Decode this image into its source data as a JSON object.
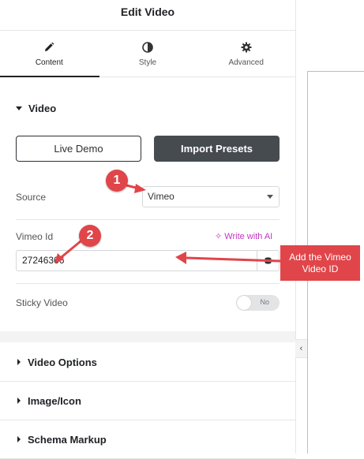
{
  "header": {
    "title": "Edit Video"
  },
  "tabs": [
    {
      "label": "Content",
      "icon": "pencil-icon"
    },
    {
      "label": "Style",
      "icon": "half-circle-icon"
    },
    {
      "label": "Advanced",
      "icon": "gear-icon"
    }
  ],
  "video_section": {
    "title": "Video",
    "demo_button": "Live Demo",
    "import_button": "Import Presets",
    "source_label": "Source",
    "source_value": "Vimeo",
    "vimeo_label": "Vimeo Id",
    "ai_link": "Write with AI",
    "vimeo_value": "27246366",
    "sticky_label": "Sticky Video",
    "sticky_toggle": "No"
  },
  "collapsed_sections": [
    "Video Options",
    "Image/Icon",
    "Schema Markup"
  ],
  "annotations": {
    "marker_1": "1",
    "marker_2": "2",
    "callout": "Add the Vimeo Video ID"
  },
  "colors": {
    "accent": "#e0454a",
    "ai": "#c036c0",
    "dark_button": "#464b50"
  }
}
